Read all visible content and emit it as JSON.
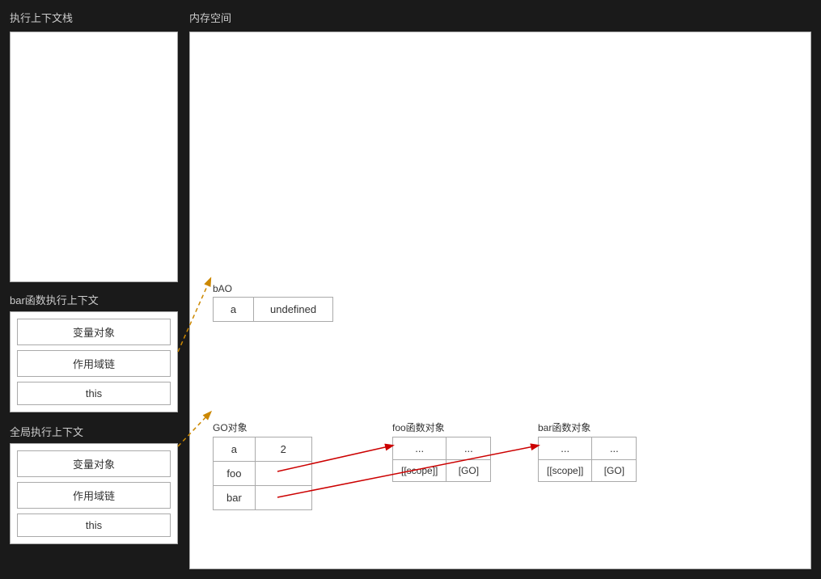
{
  "left_panel": {
    "title": "执行上下文栈",
    "bar_ctx": {
      "label": "bar函数执行上下文",
      "items": [
        "变量对象",
        "作用域链",
        "this"
      ]
    },
    "global_ctx": {
      "label": "全局执行上下文",
      "items": [
        "变量对象",
        "作用域链",
        "this"
      ]
    }
  },
  "right_panel": {
    "title": "内存空间",
    "bao_object": {
      "label": "bAO",
      "rows": [
        {
          "key": "a",
          "val": "undefined"
        }
      ]
    },
    "go_object": {
      "label": "GO对象",
      "rows": [
        {
          "key": "a",
          "val": "2"
        },
        {
          "key": "foo",
          "val": ""
        },
        {
          "key": "bar",
          "val": ""
        }
      ]
    },
    "foo_object": {
      "label": "foo函数对象",
      "rows": [
        {
          "col1": "...",
          "col2": "..."
        },
        {
          "col1": "[[scope]]",
          "col2": "[GO]"
        }
      ]
    },
    "bar_object": {
      "label": "bar函数对象",
      "rows": [
        {
          "col1": "...",
          "col2": "..."
        },
        {
          "col1": "[[scope]]",
          "col2": "[GO]"
        }
      ]
    }
  }
}
